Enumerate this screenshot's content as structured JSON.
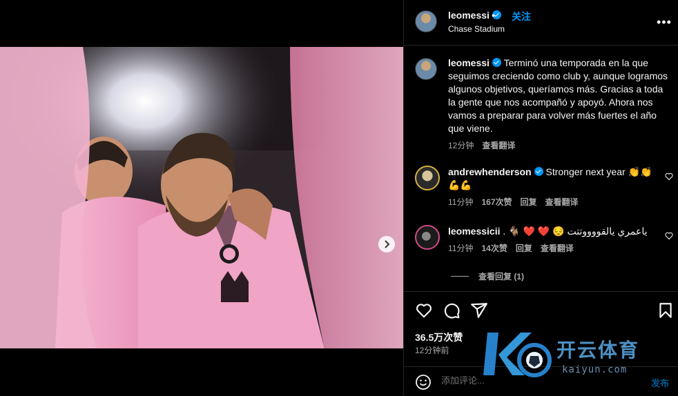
{
  "post": {
    "username": "leomessi",
    "follow_label": "关注",
    "separator": "•",
    "location": "Chase Stadium",
    "more_label": "•••",
    "image_count": 5,
    "image_active_index": 0
  },
  "caption": {
    "username": "leomessi",
    "text": "Terminó una temporada en la que seguimos creciendo como club y, aunque logramos algunos objetivos, queríamos más. Gracias a toda la gente que nos acompañó y apoyó. Ahora nos vamos a preparar para volver más fuertes el año que viene.",
    "time": "12分钟",
    "translate_label": "查看翻译"
  },
  "comments": [
    {
      "username": "andrewhenderson",
      "verified": true,
      "text": "Stronger next year 👏👏 💪💪",
      "time": "11分钟",
      "likes": "167次赞",
      "reply_label": "回复",
      "translate_label": "查看翻译"
    },
    {
      "username": "leomessicii",
      "verified": false,
      "text": ". 🐐 ❤️ ❤️ 😔 ياعمري يالقووووتتت",
      "time": "11分钟",
      "likes": "14次赞",
      "reply_label": "回复",
      "translate_label": "查看翻译"
    }
  ],
  "view_replies_label": "查看回复 (1)",
  "stats": {
    "likes": "36.5万次赞",
    "posted": "12分钟前"
  },
  "composer": {
    "placeholder": "添加评论...",
    "post_label": "发布"
  },
  "watermark": {
    "brand": "开云体育",
    "site": "kaiyun.com"
  },
  "icons": {
    "like": "heart-icon",
    "comment": "comment-icon",
    "share": "share-icon",
    "save": "bookmark-icon",
    "emoji": "emoji-icon",
    "next": "chevron-right-icon",
    "verified": "verified-badge-icon"
  },
  "colors": {
    "accent": "#0095f6",
    "jersey_pink": "#f2a1c3",
    "background": "#000000",
    "muted_text": "#a8a8a8"
  }
}
